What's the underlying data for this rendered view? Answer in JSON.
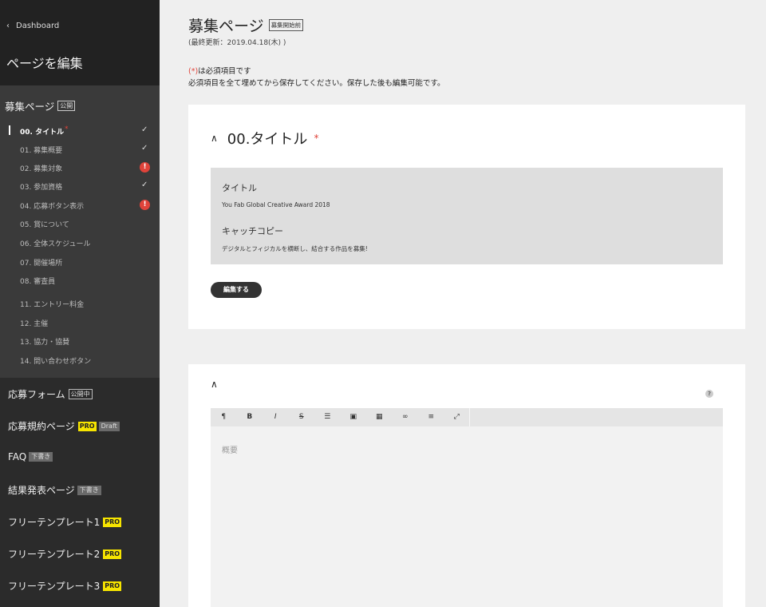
{
  "sidebar": {
    "back_label": "Dashboard",
    "title": "ページを編集",
    "section": {
      "title": "募集ページ",
      "badge": "公開",
      "items": [
        {
          "label": "00. タイトル",
          "state": "check",
          "required": true,
          "active": true
        },
        {
          "label": "01. 募集概要",
          "state": "check"
        },
        {
          "label": "02. 募集対象",
          "state": "warn"
        },
        {
          "label": "03. 参加資格",
          "state": "check"
        },
        {
          "label": "04. 応募ボタン表示",
          "state": "warn"
        },
        {
          "label": "05. 賞について"
        },
        {
          "label": "06. 全体スケジュール"
        },
        {
          "label": "07. 開催場所"
        },
        {
          "label": "08. 審査員"
        },
        {
          "label": "11. エントリー料金"
        },
        {
          "label": "12. 主催"
        },
        {
          "label": "13. 協力・協賛"
        },
        {
          "label": "14. 問い合わせボタン"
        }
      ]
    },
    "pages": [
      {
        "label": "応募フォーム",
        "badges": [
          {
            "type": "outline",
            "text": "公開中"
          }
        ]
      },
      {
        "label": "応募規約ページ",
        "badges": [
          {
            "type": "pro",
            "text": "PRO"
          },
          {
            "type": "gray",
            "text": "Draft"
          }
        ]
      },
      {
        "label": "FAQ",
        "badges": [
          {
            "type": "gray",
            "text": "下書き"
          }
        ]
      },
      {
        "label": "結果発表ページ",
        "badges": [
          {
            "type": "gray",
            "text": "下書き"
          }
        ]
      },
      {
        "label": "フリーテンプレート1",
        "badges": [
          {
            "type": "pro",
            "text": "PRO"
          }
        ]
      },
      {
        "label": "フリーテンプレート2",
        "badges": [
          {
            "type": "pro",
            "text": "PRO"
          }
        ]
      },
      {
        "label": "フリーテンプレート3",
        "badges": [
          {
            "type": "pro",
            "text": "PRO"
          }
        ]
      }
    ]
  },
  "main": {
    "title": "募集ページ",
    "status": "募集開始前",
    "last_updated": "(最終更新：2019.04.18(木) )",
    "note_required_mark": "(*)",
    "note_required_text": "は必須項目です",
    "note_save": "必須項目を全て埋めてから保存してください。保存した後も編集可能です。",
    "card1": {
      "heading": "00.タイトル",
      "required_mark": "*",
      "title_label": "タイトル",
      "title_value": "You Fab Global Creative Award 2018",
      "copy_label": "キャッチコピー",
      "copy_value": "デジタルとフィジカルを横断し、結合する作品を募集!",
      "edit_button": "編集する"
    },
    "card2": {
      "help": "?",
      "editor_placeholder": "概要",
      "toolbar": [
        "¶",
        "B",
        "I",
        "S",
        "☰",
        "▣",
        "▦",
        "∞",
        "≡",
        "⤢"
      ]
    }
  }
}
